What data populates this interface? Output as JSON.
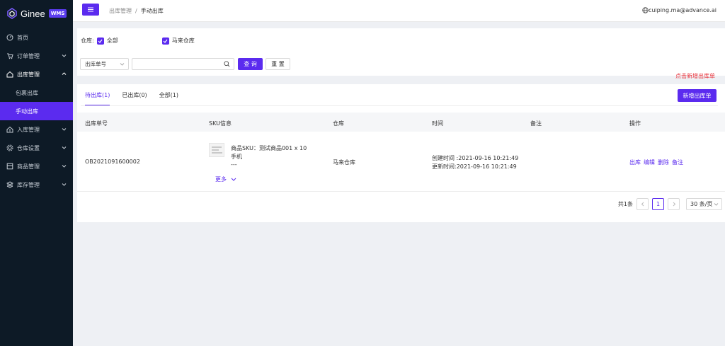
{
  "brand": {
    "name": "Ginee",
    "badge": "WMS",
    "accent": "#5b2bef"
  },
  "sidebar": {
    "items": [
      {
        "label": "首页",
        "icon": "dashboard-icon"
      },
      {
        "label": "订单管理",
        "icon": "cart-icon"
      },
      {
        "label": "出库管理",
        "icon": "outbound-icon",
        "open": true,
        "children": [
          {
            "label": "包裹出库"
          },
          {
            "label": "手动出库",
            "active": true
          }
        ]
      },
      {
        "label": "入库管理",
        "icon": "inbound-icon"
      },
      {
        "label": "仓库设置",
        "icon": "warehouse-icon"
      },
      {
        "label": "商品管理",
        "icon": "product-icon"
      },
      {
        "label": "库存管理",
        "icon": "inventory-icon"
      }
    ]
  },
  "header": {
    "breadcrumb_parent": "出库管理",
    "breadcrumb_sep": "/",
    "breadcrumb_current": "手动出库",
    "user_email": "cuiping.ma@advance.ai"
  },
  "filter": {
    "warehouse_label": "仓库:",
    "warehouse_all": "全部",
    "warehouse_option": "马来仓库",
    "field_select": "出库单号",
    "search_value": "",
    "search_button": "查 询",
    "reset_button": "重 置"
  },
  "hint": "点击新增出库单",
  "tabs": [
    {
      "label": "待出库(1)",
      "active": true
    },
    {
      "label": "已出库(0)"
    },
    {
      "label": "全部(1)"
    }
  ],
  "new_button": "新增出库单",
  "table": {
    "headers": [
      "出库单号",
      "SKU信息",
      "仓库",
      "时间",
      "备注",
      "操作"
    ],
    "rows": [
      {
        "order_no": "OB2021091600002",
        "sku_line1": "商品SKU：测试商品001 x 10",
        "sku_line2": "手机",
        "sku_line3": "---",
        "more": "更多",
        "warehouse": "马来仓库",
        "created": "创建时间 :2021-09-16 10:21:49",
        "updated": "更新时间:2021-09-16 10:21:49",
        "remark": "",
        "actions": [
          "出库",
          "编辑",
          "删除",
          "备注"
        ]
      }
    ]
  },
  "pager": {
    "total": "共1条",
    "current": "1",
    "size": "30 条/页"
  }
}
